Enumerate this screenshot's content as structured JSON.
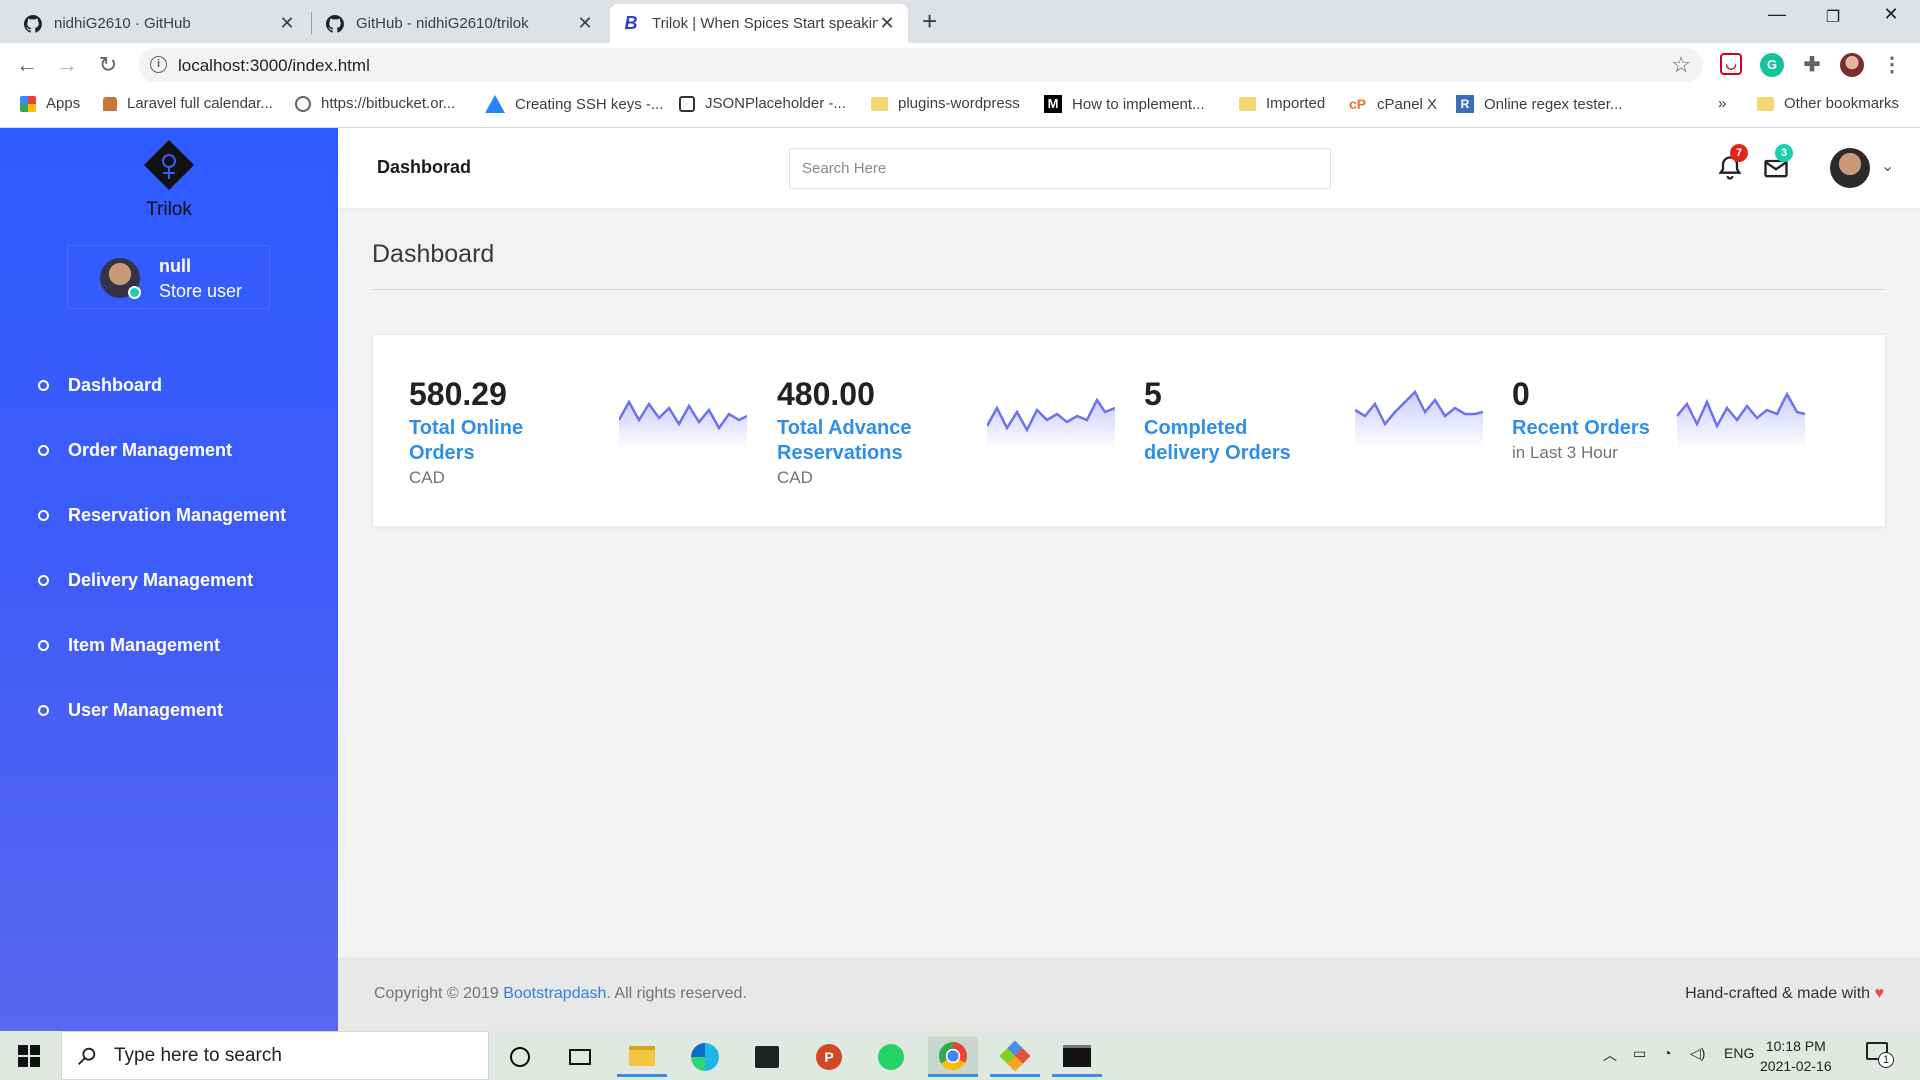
{
  "browser": {
    "tabs": [
      {
        "title": "nidhiG2610 · GitHub",
        "icon": "github-icon"
      },
      {
        "title": "GitHub - nidhiG2610/trilok",
        "icon": "github-icon"
      },
      {
        "title": "Trilok | When Spices Start speakin",
        "icon": "bootstrap-icon",
        "active": true
      }
    ],
    "url": "localhost:3000/index.html",
    "bookmarks": [
      {
        "label": "Apps"
      },
      {
        "label": "Laravel full calendar..."
      },
      {
        "label": "https://bitbucket.or..."
      },
      {
        "label": "Creating SSH keys -..."
      },
      {
        "label": "JSONPlaceholder -..."
      },
      {
        "label": "plugins-wordpress"
      },
      {
        "label": "How to implement..."
      },
      {
        "label": "Imported"
      },
      {
        "label": "cPanel X"
      },
      {
        "label": "Online regex tester..."
      }
    ],
    "bookmarks_overflow": "»",
    "other_bookmarks": "Other bookmarks"
  },
  "sidebar": {
    "logo_text": "Trilok",
    "user": {
      "name": "null",
      "role": "Store user"
    },
    "items": [
      {
        "label": "Dashboard"
      },
      {
        "label": "Order Management"
      },
      {
        "label": "Reservation Management"
      },
      {
        "label": "Delivery Management"
      },
      {
        "label": "Item Management"
      },
      {
        "label": "User Management"
      }
    ]
  },
  "topbar": {
    "brand": "Dashborad",
    "search_placeholder": "Search Here",
    "notifications_count": "7",
    "messages_count": "3"
  },
  "page": {
    "title": "Dashboard"
  },
  "stats": [
    {
      "value": "580.29",
      "label": "Total Online Orders",
      "sub": "CAD"
    },
    {
      "value": "480.00",
      "label": "Total Advance Reservations",
      "sub": "CAD"
    },
    {
      "value": "5",
      "label": "Completed delivery Orders",
      "sub": ""
    },
    {
      "value": "0",
      "label": "Recent Orders",
      "sub": "in Last 3 Hour"
    }
  ],
  "footer": {
    "copyright_prefix": "Copyright © 2019 ",
    "link": "Bootstrapdash",
    "copyright_suffix": ". All rights reserved.",
    "made": "Hand-crafted & made with ",
    "heart": "♥"
  },
  "taskbar": {
    "search_placeholder": "Type here to search",
    "language": "ENG",
    "time": "10:18 PM",
    "date": "2021-02-16",
    "notifications": "1"
  },
  "colors": {
    "sidebar": "#2e5bff",
    "accent": "#2f8fe6",
    "spark": "#6d72f0",
    "danger_badge": "#e3261b",
    "success_badge": "#1bcfb4"
  }
}
